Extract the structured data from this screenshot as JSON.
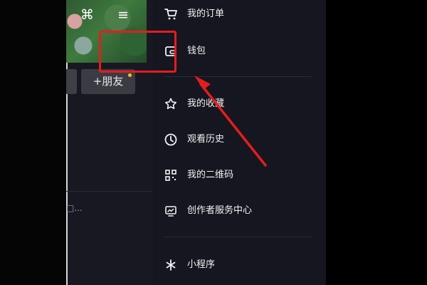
{
  "profile": {
    "add_friend_label": "+朋友",
    "left_fragment": "□..."
  },
  "drawer": {
    "items": [
      {
        "label": "我的订单",
        "icon": "cart-icon"
      },
      {
        "label": "钱包",
        "icon": "wallet-icon"
      },
      {
        "label": "我的收藏",
        "icon": "star-icon"
      },
      {
        "label": "观看历史",
        "icon": "clock-icon"
      },
      {
        "label": "我的二维码",
        "icon": "qr-code-icon"
      },
      {
        "label": "创作者服务中心",
        "icon": "creator-service-icon"
      },
      {
        "label": "小程序",
        "icon": "mini-program-icon"
      }
    ]
  },
  "annotation": {
    "highlight_color": "#e41d1d",
    "highlighted_item": "钱包"
  }
}
